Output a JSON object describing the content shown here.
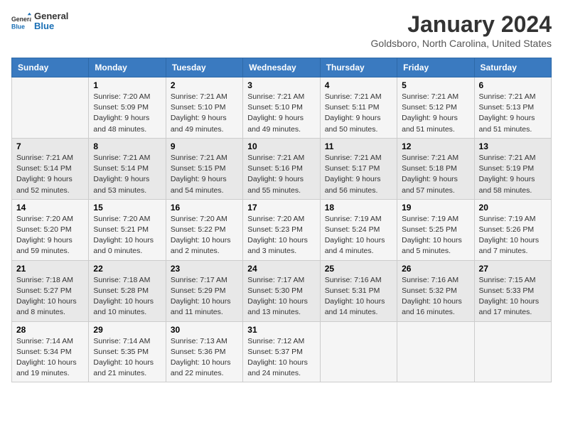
{
  "header": {
    "logo_line1": "General",
    "logo_line2": "Blue",
    "month_title": "January 2024",
    "location": "Goldsboro, North Carolina, United States"
  },
  "days_of_week": [
    "Sunday",
    "Monday",
    "Tuesday",
    "Wednesday",
    "Thursday",
    "Friday",
    "Saturday"
  ],
  "weeks": [
    [
      {
        "day": null,
        "sunrise": null,
        "sunset": null,
        "daylight": null
      },
      {
        "day": "1",
        "sunrise": "7:20 AM",
        "sunset": "5:09 PM",
        "daylight": "9 hours and 48 minutes."
      },
      {
        "day": "2",
        "sunrise": "7:21 AM",
        "sunset": "5:10 PM",
        "daylight": "9 hours and 49 minutes."
      },
      {
        "day": "3",
        "sunrise": "7:21 AM",
        "sunset": "5:10 PM",
        "daylight": "9 hours and 49 minutes."
      },
      {
        "day": "4",
        "sunrise": "7:21 AM",
        "sunset": "5:11 PM",
        "daylight": "9 hours and 50 minutes."
      },
      {
        "day": "5",
        "sunrise": "7:21 AM",
        "sunset": "5:12 PM",
        "daylight": "9 hours and 51 minutes."
      },
      {
        "day": "6",
        "sunrise": "7:21 AM",
        "sunset": "5:13 PM",
        "daylight": "9 hours and 51 minutes."
      }
    ],
    [
      {
        "day": "7",
        "sunrise": "7:21 AM",
        "sunset": "5:14 PM",
        "daylight": "9 hours and 52 minutes."
      },
      {
        "day": "8",
        "sunrise": "7:21 AM",
        "sunset": "5:14 PM",
        "daylight": "9 hours and 53 minutes."
      },
      {
        "day": "9",
        "sunrise": "7:21 AM",
        "sunset": "5:15 PM",
        "daylight": "9 hours and 54 minutes."
      },
      {
        "day": "10",
        "sunrise": "7:21 AM",
        "sunset": "5:16 PM",
        "daylight": "9 hours and 55 minutes."
      },
      {
        "day": "11",
        "sunrise": "7:21 AM",
        "sunset": "5:17 PM",
        "daylight": "9 hours and 56 minutes."
      },
      {
        "day": "12",
        "sunrise": "7:21 AM",
        "sunset": "5:18 PM",
        "daylight": "9 hours and 57 minutes."
      },
      {
        "day": "13",
        "sunrise": "7:21 AM",
        "sunset": "5:19 PM",
        "daylight": "9 hours and 58 minutes."
      }
    ],
    [
      {
        "day": "14",
        "sunrise": "7:20 AM",
        "sunset": "5:20 PM",
        "daylight": "9 hours and 59 minutes."
      },
      {
        "day": "15",
        "sunrise": "7:20 AM",
        "sunset": "5:21 PM",
        "daylight": "10 hours and 0 minutes."
      },
      {
        "day": "16",
        "sunrise": "7:20 AM",
        "sunset": "5:22 PM",
        "daylight": "10 hours and 2 minutes."
      },
      {
        "day": "17",
        "sunrise": "7:20 AM",
        "sunset": "5:23 PM",
        "daylight": "10 hours and 3 minutes."
      },
      {
        "day": "18",
        "sunrise": "7:19 AM",
        "sunset": "5:24 PM",
        "daylight": "10 hours and 4 minutes."
      },
      {
        "day": "19",
        "sunrise": "7:19 AM",
        "sunset": "5:25 PM",
        "daylight": "10 hours and 5 minutes."
      },
      {
        "day": "20",
        "sunrise": "7:19 AM",
        "sunset": "5:26 PM",
        "daylight": "10 hours and 7 minutes."
      }
    ],
    [
      {
        "day": "21",
        "sunrise": "7:18 AM",
        "sunset": "5:27 PM",
        "daylight": "10 hours and 8 minutes."
      },
      {
        "day": "22",
        "sunrise": "7:18 AM",
        "sunset": "5:28 PM",
        "daylight": "10 hours and 10 minutes."
      },
      {
        "day": "23",
        "sunrise": "7:17 AM",
        "sunset": "5:29 PM",
        "daylight": "10 hours and 11 minutes."
      },
      {
        "day": "24",
        "sunrise": "7:17 AM",
        "sunset": "5:30 PM",
        "daylight": "10 hours and 13 minutes."
      },
      {
        "day": "25",
        "sunrise": "7:16 AM",
        "sunset": "5:31 PM",
        "daylight": "10 hours and 14 minutes."
      },
      {
        "day": "26",
        "sunrise": "7:16 AM",
        "sunset": "5:32 PM",
        "daylight": "10 hours and 16 minutes."
      },
      {
        "day": "27",
        "sunrise": "7:15 AM",
        "sunset": "5:33 PM",
        "daylight": "10 hours and 17 minutes."
      }
    ],
    [
      {
        "day": "28",
        "sunrise": "7:14 AM",
        "sunset": "5:34 PM",
        "daylight": "10 hours and 19 minutes."
      },
      {
        "day": "29",
        "sunrise": "7:14 AM",
        "sunset": "5:35 PM",
        "daylight": "10 hours and 21 minutes."
      },
      {
        "day": "30",
        "sunrise": "7:13 AM",
        "sunset": "5:36 PM",
        "daylight": "10 hours and 22 minutes."
      },
      {
        "day": "31",
        "sunrise": "7:12 AM",
        "sunset": "5:37 PM",
        "daylight": "10 hours and 24 minutes."
      },
      {
        "day": null,
        "sunrise": null,
        "sunset": null,
        "daylight": null
      },
      {
        "day": null,
        "sunrise": null,
        "sunset": null,
        "daylight": null
      },
      {
        "day": null,
        "sunrise": null,
        "sunset": null,
        "daylight": null
      }
    ]
  ],
  "labels": {
    "sunrise_prefix": "Sunrise: ",
    "sunset_prefix": "Sunset: ",
    "daylight_prefix": "Daylight: "
  }
}
